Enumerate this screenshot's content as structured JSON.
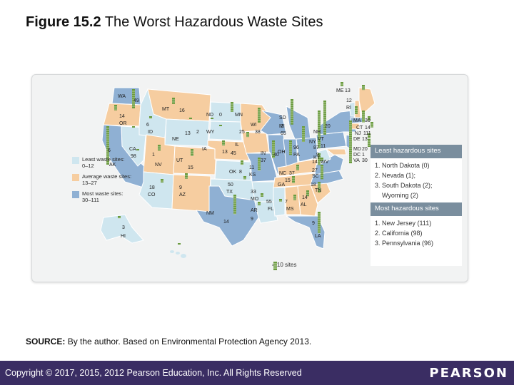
{
  "title": {
    "figure_number": "Figure 15.2",
    "text": "The Worst Hazardous Waste Sites"
  },
  "legend": {
    "items": [
      {
        "label": "Least waste sites:",
        "range": "0–12",
        "color": "#cfe6ef"
      },
      {
        "label": "Average waste sites:",
        "range": "13–27",
        "color": "#f6cda0"
      },
      {
        "label": "Most waste sites:",
        "range": "30–111",
        "color": "#8fb0d3"
      }
    ],
    "scale_key": "= 10 sites"
  },
  "least_box": {
    "heading": "Least hazardous sites",
    "items": [
      "1. North Dakota (0)",
      "2. Nevada (1);",
      "3. South Dakota (2);",
      "Wyoming (2)"
    ]
  },
  "most_box": {
    "heading": "Most hazardous sites",
    "items": [
      "1. New Jersey (111)",
      "2. California (98)",
      "3. Pennsylvania (96)"
    ]
  },
  "map_labels": [
    "WA",
    "49",
    "OR",
    "14",
    "ID",
    "6",
    "MT",
    "16",
    "ND",
    "0",
    "MN",
    "25",
    "WI",
    "38",
    "MI",
    "65",
    "SD",
    "2",
    "WY",
    "2",
    "NE",
    "13",
    "IA",
    "13",
    "IL",
    "45",
    "IN",
    "37",
    "OH",
    "40",
    "PA",
    "96",
    "NY",
    "87",
    "VT",
    "11",
    "NH",
    "20",
    "ME",
    "13",
    "MA",
    "30",
    "RI",
    "12",
    "CT",
    "14",
    "NJ",
    "111",
    "DE",
    "13",
    "MD",
    "20",
    "DC",
    "1",
    "VA",
    "30",
    "WV",
    "9",
    "KY",
    "14",
    "NC",
    "37",
    "SC",
    "27",
    "TN",
    "18",
    "GA",
    "15",
    "AL",
    "14",
    "MS",
    "7",
    "FL",
    "55",
    "LA",
    "9",
    "AR",
    "9",
    "MO",
    "33",
    "KS",
    "11",
    "OK",
    "8",
    "TX",
    "50",
    "NM",
    "14",
    "AZ",
    "9",
    "CO",
    "18",
    "UT",
    "15",
    "NV",
    "1",
    "CA",
    "98",
    "AK",
    "6",
    "HI",
    "3"
  ],
  "source": {
    "prefix": "SOURCE:",
    "text": "By the author. Based on Environmental Protection Agency 2013."
  },
  "footer": {
    "copyright": "Copyright © 2017, 2015, 2012 Pearson Education, Inc. All Rights Reserved",
    "brand": "PEARSON"
  }
}
